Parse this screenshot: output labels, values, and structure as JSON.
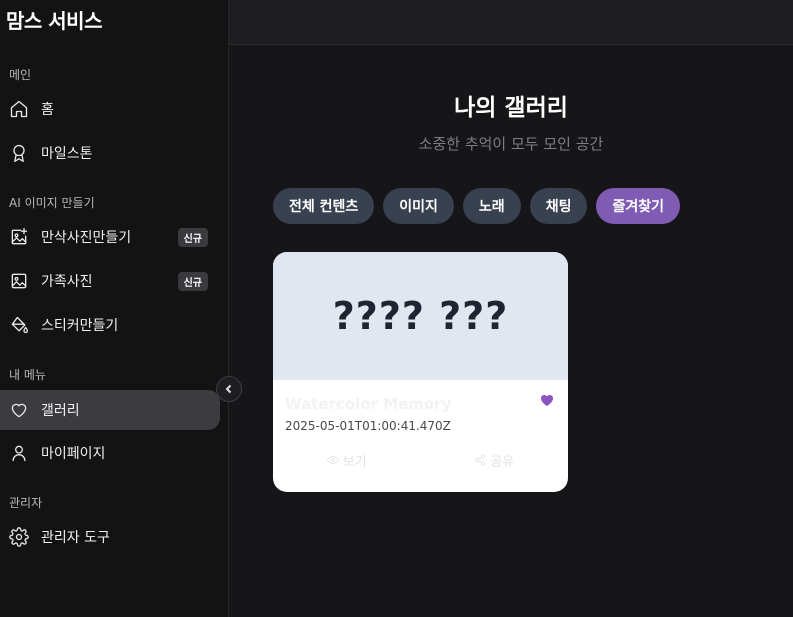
{
  "app": {
    "brand": "맘스 서비스"
  },
  "sidebar": {
    "sections": {
      "main": "메인",
      "ai": "AI 이미지 만들기",
      "my": "내 메뉴",
      "admin": "관리자"
    },
    "items": {
      "home": {
        "label": "홈",
        "icon": "home-icon"
      },
      "milestone": {
        "label": "마일스톤",
        "icon": "award-icon"
      },
      "maternity": {
        "label": "만삭사진만들기",
        "icon": "image-plus-icon",
        "badge": "신규"
      },
      "family": {
        "label": "가족사진",
        "icon": "image-icon",
        "badge": "신규"
      },
      "sticker": {
        "label": "스티커만들기",
        "icon": "paint-bucket-icon"
      },
      "gallery": {
        "label": "갤러리",
        "icon": "heart-icon"
      },
      "mypage": {
        "label": "마이페이지",
        "icon": "user-icon"
      },
      "admin_tools": {
        "label": "관리자 도구",
        "icon": "gear-icon"
      }
    }
  },
  "main": {
    "title": "나의 갤러리",
    "subtitle": "소중한 추억이 모두 모인 공간",
    "tabs": [
      "전체 컨텐츠",
      "이미지",
      "노래",
      "채팅",
      "즐겨찾기"
    ],
    "active_tab": "즐겨찾기",
    "card": {
      "thumb_text": "???? ???",
      "title": "Watercolor Memory",
      "date": "2025-05-01T01:00:41.470Z",
      "view_label": "보기",
      "share_label": "공유",
      "favorited": true
    }
  },
  "colors": {
    "accent": "#7f5bb3",
    "heart": "#8a55c2",
    "tab_bg": "#394150"
  }
}
